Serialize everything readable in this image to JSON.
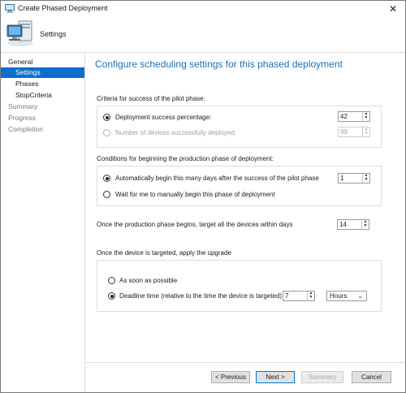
{
  "window": {
    "title": "Create Phased Deployment",
    "close_glyph": "✕"
  },
  "header": {
    "title": "Settings",
    "icon": "computer-wizard-icon"
  },
  "sidebar": {
    "items": [
      {
        "label": "General"
      },
      {
        "label": "Settings"
      },
      {
        "label": "Phases"
      },
      {
        "label": "StopCriteria"
      },
      {
        "label": "Summary"
      },
      {
        "label": "Progress"
      },
      {
        "label": "Completion"
      }
    ]
  },
  "main": {
    "title": "Configure scheduling settings for this phased deployment",
    "pilot": {
      "heading": "Criteria for success of the pilot phase:",
      "option_percentage": {
        "label": "Deployment success percentage:",
        "value": "42",
        "selected": true
      },
      "option_devices": {
        "label": "Number of devices successfully deployed:",
        "value": "99",
        "enabled": false
      }
    },
    "production": {
      "heading": "Conditions for beginning the production phase of deployment:",
      "option_auto": {
        "label": "Automatically begin this many days after the success of the pilot phase",
        "value": "1",
        "selected": true
      },
      "option_manual": {
        "label": "Wait for me to manually begin this phase of deployment"
      }
    },
    "target_days": {
      "label": "Once the production phase begins, target all the devices within days",
      "value": "14"
    },
    "upgrade": {
      "heading": "Once the device is targeted,  apply the upgrade",
      "option_asap": {
        "label": "As soon as possible"
      },
      "option_deadline": {
        "label": "Deadline time (relative to the time the device is targeted)",
        "value": "7",
        "unit": "Hours",
        "selected": true
      }
    }
  },
  "footer": {
    "previous": "< Previous",
    "next": "Next >",
    "summary": "Summary",
    "cancel": "Cancel"
  },
  "glyphs": {
    "up": "▲",
    "down": "▼",
    "chevron": "⌄"
  },
  "colors": {
    "accent": "#0a6ecf",
    "title_blue": "#1f6fb2"
  }
}
